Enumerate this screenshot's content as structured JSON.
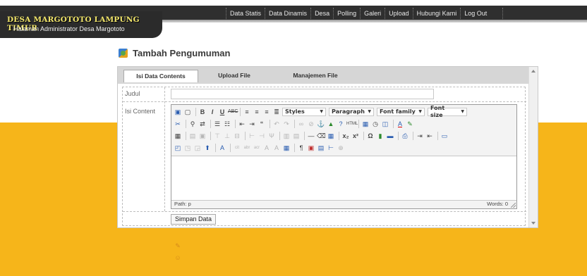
{
  "brand": {
    "title": "DESA MARGOTOTO LAMPUNG TIMUR",
    "subtitle": "Halaman Administrator Desa Margototo"
  },
  "nav": {
    "items": [
      "Data Statis",
      "Data Dinamis",
      "Desa",
      "Polling",
      "Galeri",
      "Upload",
      "Hubungi Kami",
      "Log Out"
    ]
  },
  "page": {
    "title": "Tambah Pengumuman",
    "icon": "image-icon"
  },
  "tabs": [
    "Isi Data Contents",
    "Upload File",
    "Manajemen File"
  ],
  "form": {
    "judul_label": "Judul",
    "content_label": "Isi Content",
    "judul_value": "",
    "save_label": "Simpan Data"
  },
  "editor": {
    "dropdowns": [
      "Styles",
      "Paragraph",
      "Font family",
      "Font size"
    ],
    "path_label": "Path: p",
    "words_label": "Words: 0"
  },
  "colors": {
    "header": "#2f2f2f",
    "brand_text": "#f2e66b",
    "orange_band": "#f6b51a",
    "tab_strip": "#d6d6d6"
  }
}
